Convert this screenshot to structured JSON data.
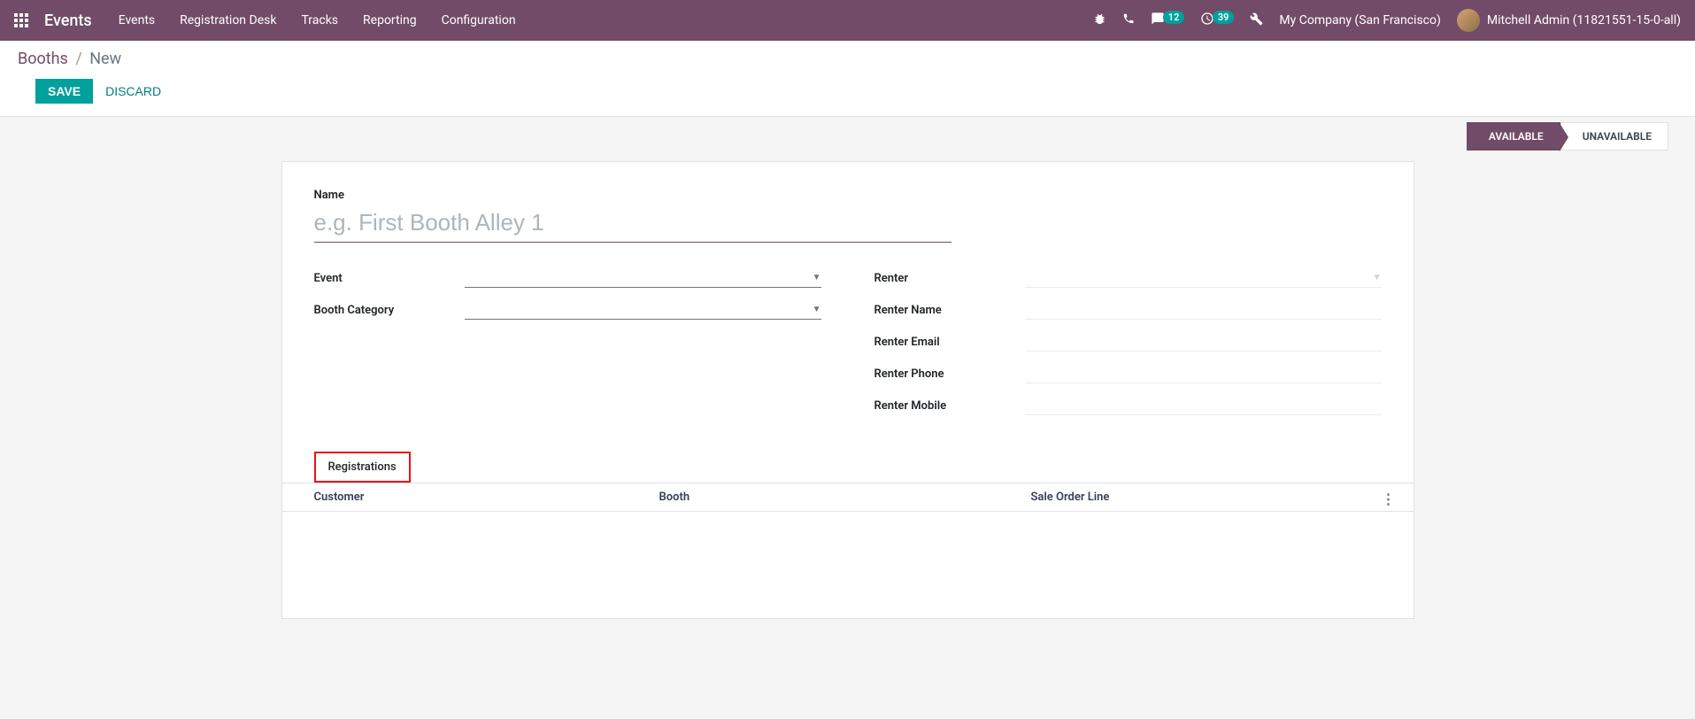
{
  "topbar": {
    "brand": "Events",
    "menu": [
      "Events",
      "Registration Desk",
      "Tracks",
      "Reporting",
      "Configuration"
    ],
    "badge_messages": "12",
    "badge_activities": "39",
    "company": "My Company (San Francisco)",
    "user": "Mitchell Admin (11821551-15-0-all)"
  },
  "breadcrumb": {
    "root": "Booths",
    "sep": "/",
    "current": "New"
  },
  "actions": {
    "save": "SAVE",
    "discard": "DISCARD"
  },
  "status": {
    "available": "AVAILABLE",
    "unavailable": "UNAVAILABLE"
  },
  "form": {
    "name_label": "Name",
    "name_placeholder": "e.g. First Booth Alley 1",
    "event_label": "Event",
    "booth_category_label": "Booth Category",
    "renter_label": "Renter",
    "renter_name_label": "Renter Name",
    "renter_email_label": "Renter Email",
    "renter_phone_label": "Renter Phone",
    "renter_mobile_label": "Renter Mobile"
  },
  "tabs": {
    "registrations": "Registrations"
  },
  "table": {
    "col_customer": "Customer",
    "col_booth": "Booth",
    "col_sale_order_line": "Sale Order Line"
  }
}
